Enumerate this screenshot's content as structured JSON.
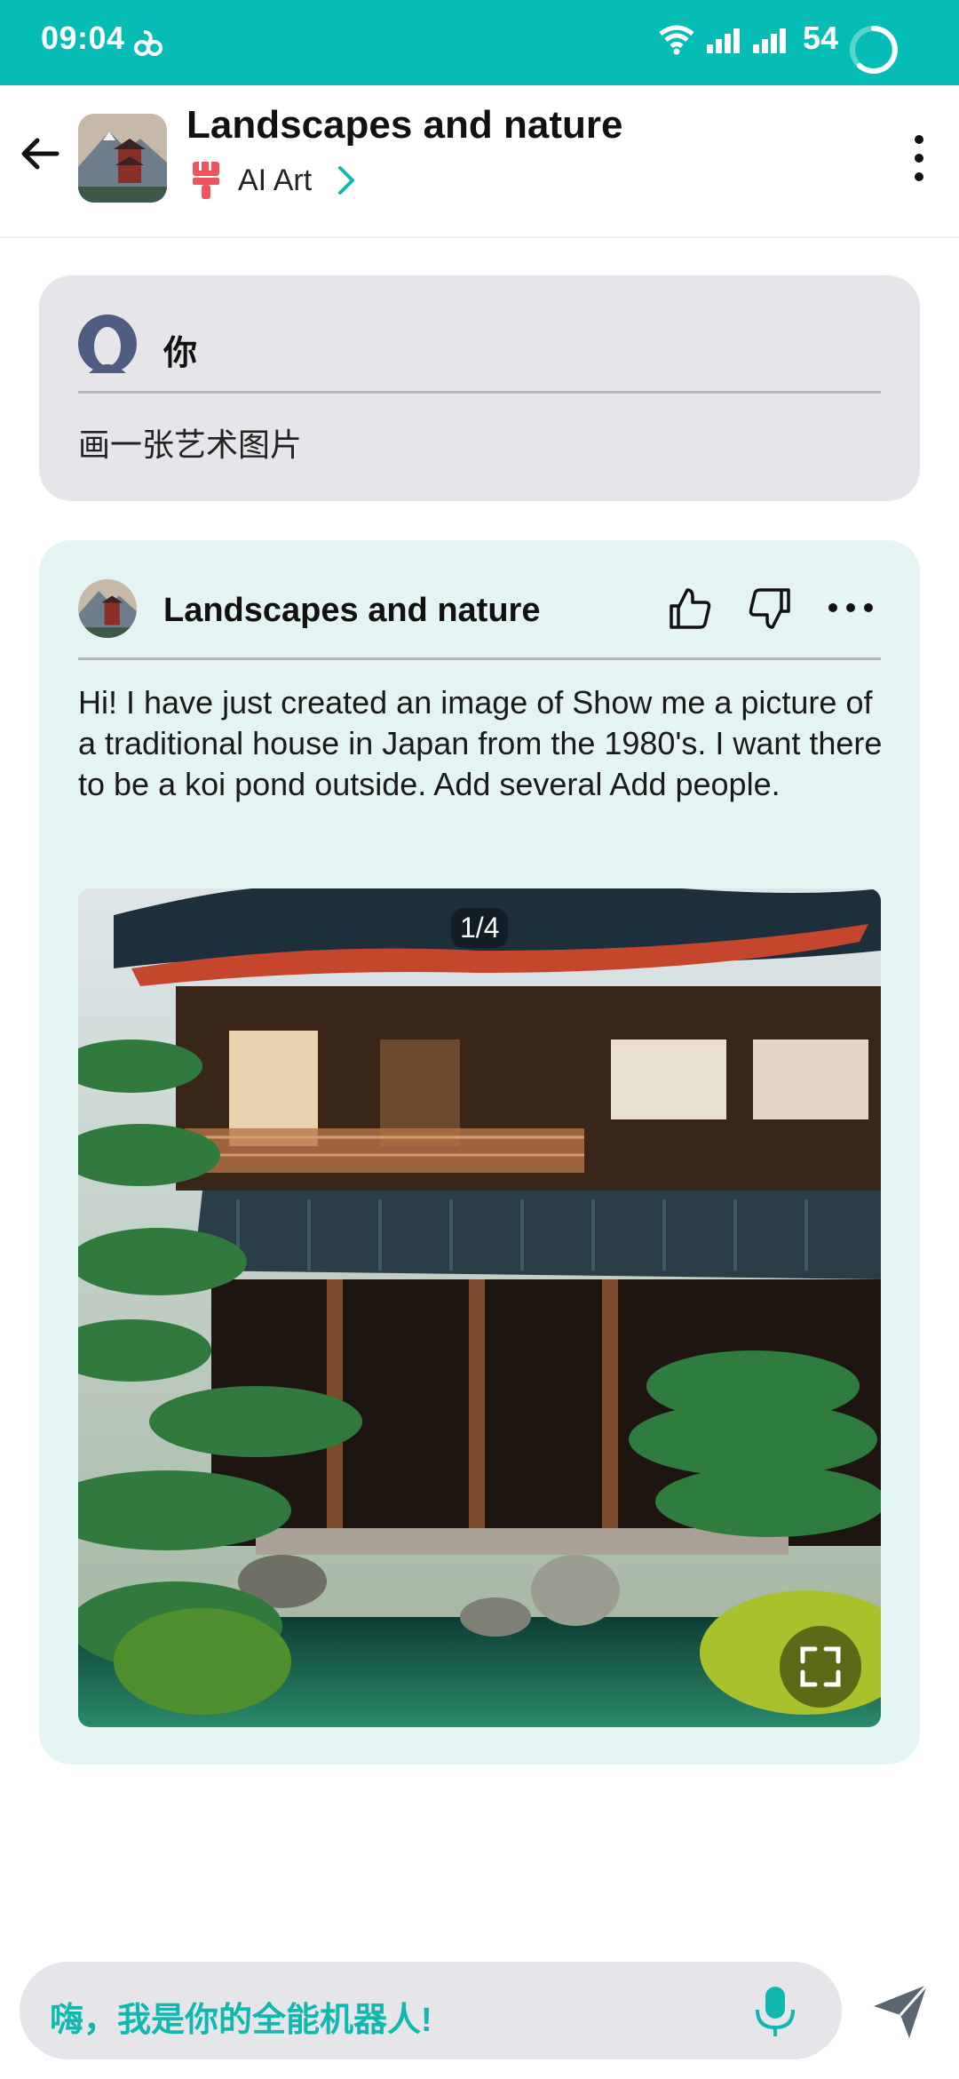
{
  "status_bar": {
    "time": "09:04",
    "battery": "54"
  },
  "header": {
    "title": "Landscapes and nature",
    "category": "AI Art",
    "icons": [
      "back-arrow-icon",
      "bot-avatar",
      "brush-icon",
      "chevron-right-icon",
      "more-vertical-icon"
    ]
  },
  "user_message": {
    "name": "你",
    "text": "画一张艺术图片"
  },
  "bot_message": {
    "name": "Landscapes and nature",
    "text": "Hi! I have just created an image of Show me a picture of a traditional house in Japan from the 1980's. I want there to be a koi pond outside. Add several Add people.",
    "image_counter": "1/4",
    "icons": [
      "thumbs-up-icon",
      "thumbs-down-icon",
      "more-horizontal-icon",
      "expand-icon"
    ]
  },
  "input": {
    "placeholder": "嗨，我是你的全能机器人!"
  },
  "colors": {
    "accent": "#05bdb4",
    "user_card_bg": "#e6e6ea",
    "bot_card_bg": "#e3f4f3",
    "placeholder_text": "#11b8ae"
  }
}
